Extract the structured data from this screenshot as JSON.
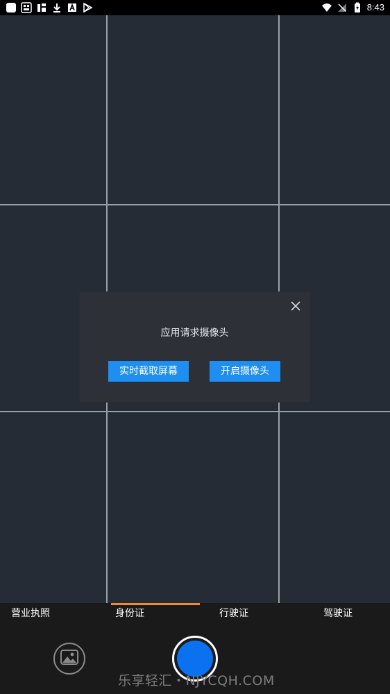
{
  "status_bar": {
    "time": "8:43",
    "left_icons": [
      "app-square-icon",
      "news-app-icon",
      "explosion-app-icon",
      "download-icon",
      "font-app-icon",
      "play-store-icon"
    ],
    "right_icons": [
      "wifi-icon",
      "no-signal-icon",
      "battery-charging-icon"
    ]
  },
  "dialog": {
    "message": "应用请求摄像头",
    "screen_capture_label": "实时截取屏幕",
    "open_camera_label": "开启摄像头"
  },
  "tabs": {
    "items": [
      {
        "label": "营业执照"
      },
      {
        "label": "身份证"
      },
      {
        "label": "行驶证"
      },
      {
        "label": "驾驶证"
      }
    ],
    "selected": "身份证",
    "indicator_color": "#f0893a"
  },
  "controls": {
    "shutter_color": "#0a72f0",
    "watermark": "乐享轻汇・NJYCQH.COM"
  }
}
